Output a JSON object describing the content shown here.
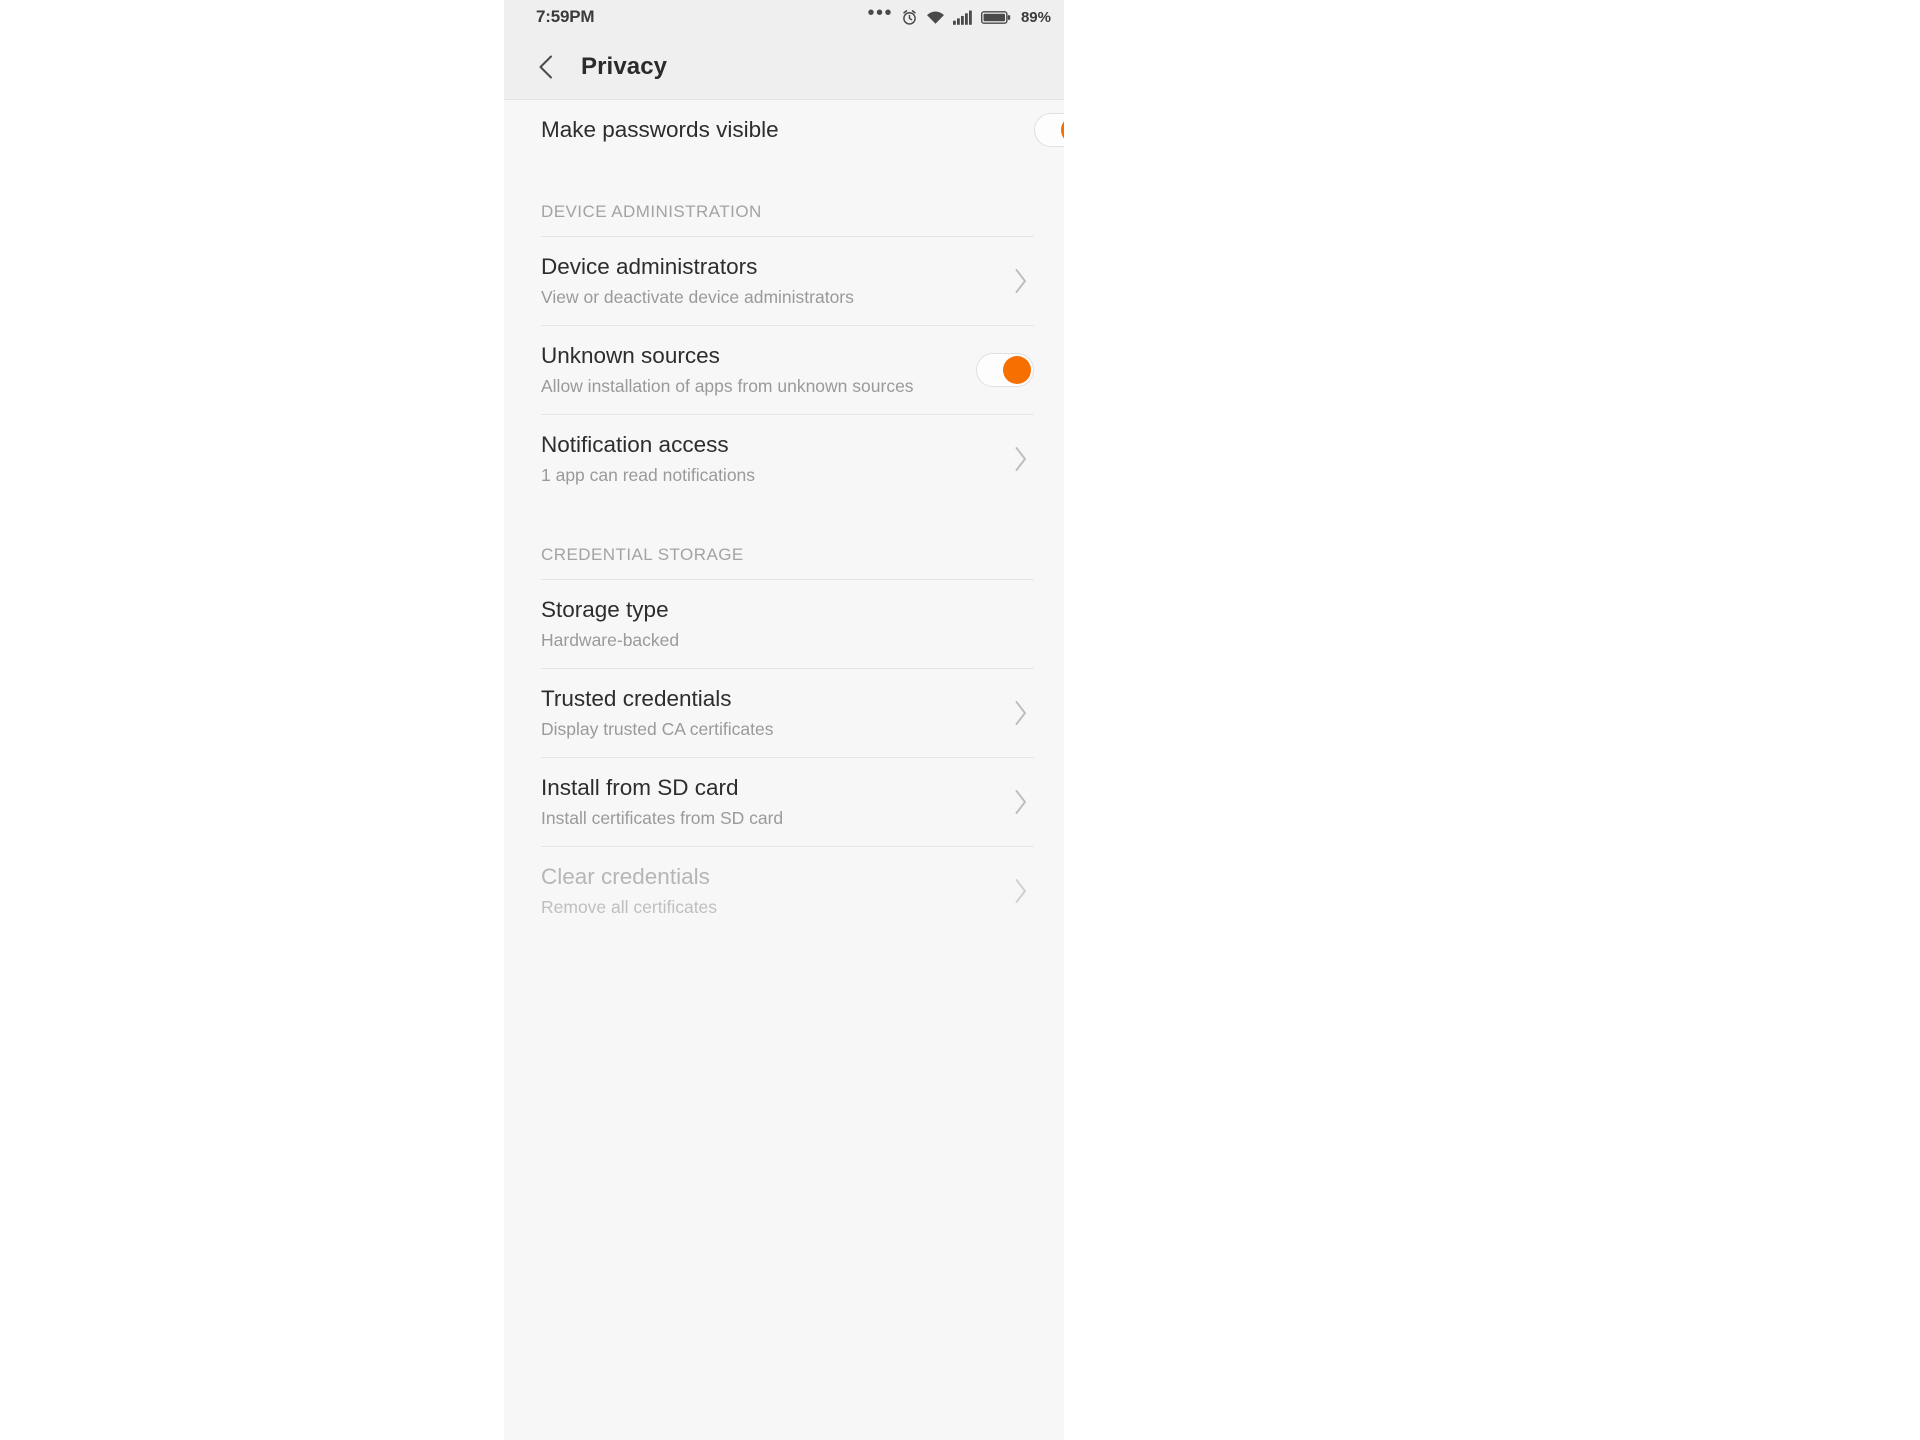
{
  "theme": {
    "accent": "#f57000",
    "page_bg": "#f7f7f7",
    "bar_bg": "#efefef",
    "title_color": "#2d2d2d",
    "subtitle_color": "#9a9a9a",
    "disabled_color": "#b6b6b6"
  },
  "status_bar": {
    "time": "7:59PM",
    "icons": [
      "more-dots-icon",
      "alarm-icon",
      "wifi-icon",
      "cellular-signal-icon",
      "battery-icon"
    ],
    "battery_percent": "89%"
  },
  "action_bar": {
    "back_icon": "chevron-left-icon",
    "title": "Privacy"
  },
  "list": [
    {
      "type": "switch_row",
      "name": "make-passwords-visible",
      "title": "Make passwords visible",
      "subtitle": "",
      "state": "on"
    },
    {
      "type": "section",
      "name": "device-administration",
      "title": "DEVICE ADMINISTRATION"
    },
    {
      "type": "nav_row",
      "name": "device-administrators",
      "title": "Device administrators",
      "subtitle": "View or deactivate device administrators",
      "chevron": "chevron-right-icon"
    },
    {
      "type": "switch_row",
      "name": "unknown-sources",
      "title": "Unknown sources",
      "subtitle": "Allow installation of apps from unknown sources",
      "state": "on"
    },
    {
      "type": "nav_row",
      "name": "notification-access",
      "title": "Notification access",
      "subtitle": "1 app can read notifications",
      "chevron": "chevron-right-icon"
    },
    {
      "type": "section",
      "name": "credential-storage",
      "title": "CREDENTIAL STORAGE"
    },
    {
      "type": "plain_row",
      "name": "storage-type",
      "title": "Storage type",
      "subtitle": "Hardware-backed"
    },
    {
      "type": "nav_row",
      "name": "trusted-credentials",
      "title": "Trusted credentials",
      "subtitle": "Display trusted CA certificates",
      "chevron": "chevron-right-icon"
    },
    {
      "type": "nav_row",
      "name": "install-from-sd-card",
      "title": "Install from SD card",
      "subtitle": "Install certificates from SD card",
      "chevron": "chevron-right-icon"
    },
    {
      "type": "nav_row",
      "name": "clear-credentials",
      "title": "Clear credentials",
      "subtitle": "Remove all certificates",
      "chevron": "chevron-right-icon",
      "disabled": true
    }
  ]
}
